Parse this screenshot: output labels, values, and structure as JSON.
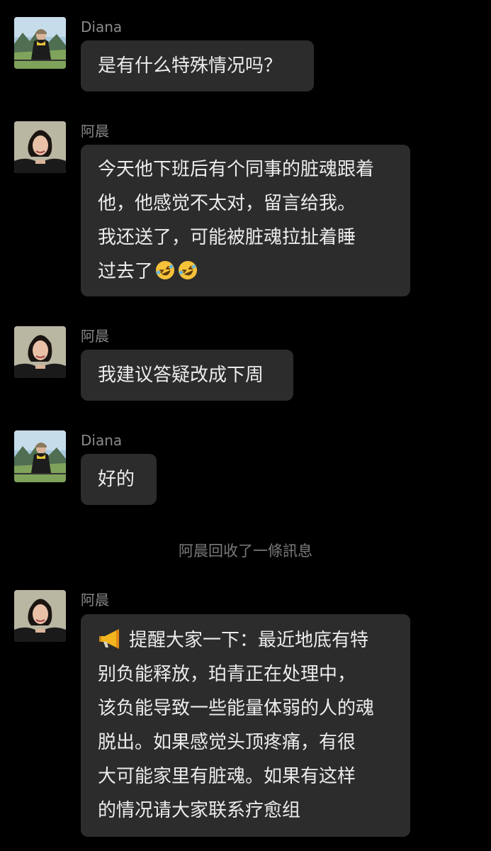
{
  "messages": [
    {
      "sender": "Diana",
      "lines": [
        "是有什么特殊情况吗？"
      ]
    },
    {
      "sender": "阿晨",
      "lines": [
        "今天他下班后有个同事的脏魂跟着",
        "他，他感觉不太对，留言给我。",
        "我还送了，可能被脏魂拉扯着睡",
        "过去了"
      ],
      "emoji": "rolling-on-floor-laughing"
    },
    {
      "sender": "阿晨",
      "lines": [
        "我建议答疑改成下周"
      ]
    },
    {
      "sender": "Diana",
      "lines": [
        "好的"
      ]
    },
    {
      "system": "阿晨回收了一條訊息"
    },
    {
      "sender": "阿晨",
      "lines": [
        "提醒大家一下：最近地底有特",
        "别负能释放，珀青正在处理中，",
        "该负能导致一些能量体弱的人的魂",
        "脱出。如果感觉头顶疼痛，有很",
        "大可能家里有脏魂。如果有这样",
        "的情况请大家联系疗愈组"
      ],
      "leading_icon": "megaphone"
    }
  ],
  "colors": {
    "background": "#000000",
    "bubble": "#2c2c2c",
    "name": "#8a8a8a",
    "text": "#ececec",
    "system": "#7a7a7a"
  }
}
